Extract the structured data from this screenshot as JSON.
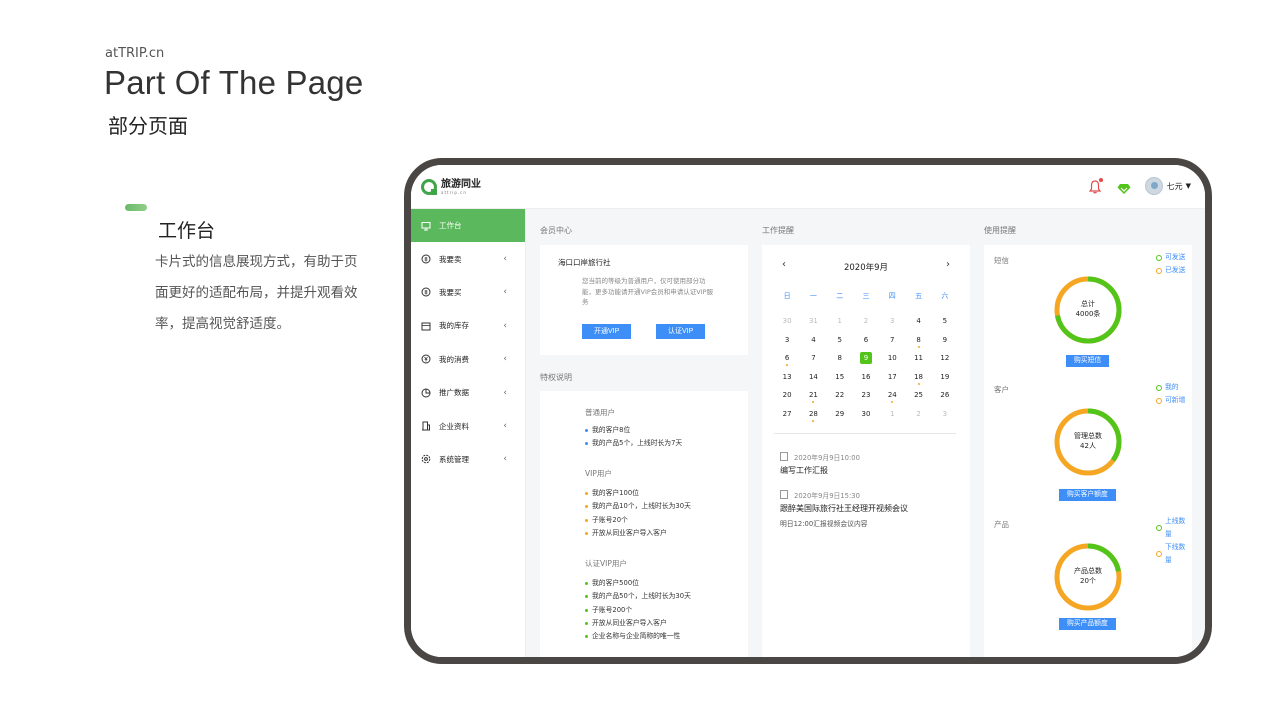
{
  "slide": {
    "brand": "atTRIP.cn",
    "title": "Part Of The Page",
    "subtitle": "部分页面",
    "section_title": "工作台",
    "section_desc": "卡片式的信息展现方式，有助于页面更好的适配布局，并提升观看效率，提高视觉舒适度。"
  },
  "app": {
    "logo_cn": "旅游同业",
    "logo_en": "attrip.cn",
    "user_name": "七元"
  },
  "sidebar": {
    "items": [
      {
        "label": "工作台"
      },
      {
        "label": "我要卖"
      },
      {
        "label": "我要买"
      },
      {
        "label": "我的库存"
      },
      {
        "label": "我的消费"
      },
      {
        "label": "推广数据"
      },
      {
        "label": "企业资料"
      },
      {
        "label": "系统管理"
      }
    ]
  },
  "member": {
    "header": "会员中心",
    "org": "海口口岸旅行社",
    "desc": "您当前的等级为普通用户，仅可使用部分功能，更多功能请开通VIP会员和申请认证VIP服务",
    "btn_open": "开通VIP",
    "btn_verify": "认证VIP"
  },
  "privileges": {
    "header": "特权说明",
    "groups": [
      {
        "title": "普通用户",
        "items": [
          "我的客户8位",
          "我的产品5个，上线时长为7天"
        ]
      },
      {
        "title": "VIP用户",
        "items": [
          "我的客户100位",
          "我的产品10个，上线时长为30天",
          "子账号20个",
          "开放从同业客户导入客户"
        ]
      },
      {
        "title": "认证VIP用户",
        "items": [
          "我的客户500位",
          "我的产品50个，上线时长为30天",
          "子账号200个",
          "开放从同业客户导入客户",
          "企业名称与企业简称的唯一性"
        ]
      }
    ]
  },
  "work": {
    "header": "工作提醒",
    "month": "2020年9月",
    "weekdays": [
      "日",
      "一",
      "二",
      "三",
      "四",
      "五",
      "六"
    ],
    "tasks": [
      {
        "time": "2020年9月9日10:00",
        "title": "编写工作汇报",
        "sub": ""
      },
      {
        "time": "2020年9月9日15:30",
        "title": "跟醉美国际旅行社王经理开视频会议",
        "sub": "明日12:00汇报视频会议内容"
      }
    ]
  },
  "usage": {
    "header": "使用提醒",
    "sms": {
      "label": "短信",
      "total_label": "总计",
      "value": "4000条",
      "btn": "购买短信",
      "legend": [
        "可发送",
        "已发送"
      ],
      "share_green": 0.72
    },
    "customers": {
      "label": "客户",
      "total_label": "管理总数",
      "value": "42人",
      "btn": "购买客户额度",
      "legend": [
        "我的",
        "可新增"
      ],
      "share_green": 0.35
    },
    "products": {
      "label": "产品",
      "total_label": "产品总数",
      "value": "20个",
      "btn": "购买产品额度",
      "legend": [
        "上线数量",
        "下线数量"
      ],
      "share_green": 0.22
    }
  },
  "colors": {
    "accent_green": "#5cb85c",
    "button_blue": "#3e8ef7",
    "ring_orange": "#f5a623",
    "ring_green": "#52c41a"
  }
}
